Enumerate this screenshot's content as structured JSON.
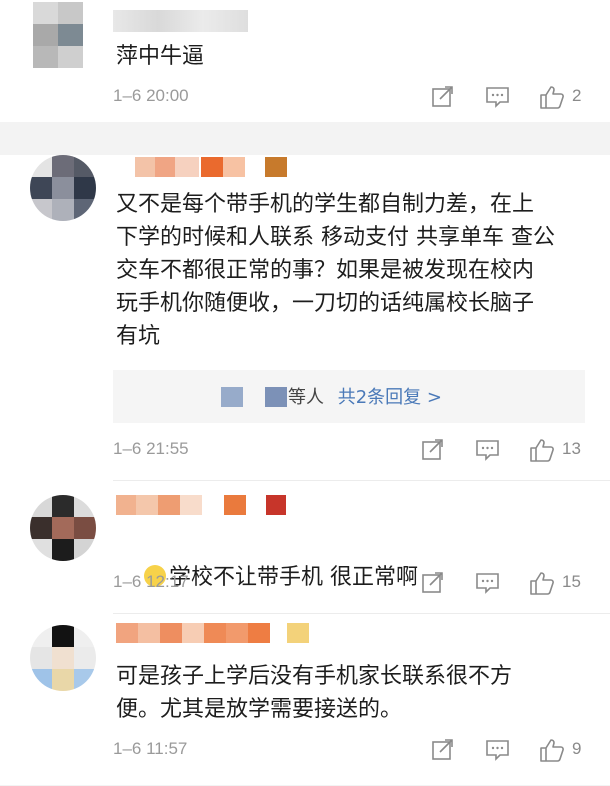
{
  "comments": [
    {
      "text": "萍中牛逼",
      "time": "1–6 20:00",
      "likes": "2",
      "icons": [
        "share-icon",
        "reply-icon",
        "like-icon"
      ]
    },
    {
      "text": "又不是每个带手机的学生都自制力差，在上\n下学的时候和人联系 移动支付 共享单车 查公\n交车不都很正常的事？如果是被发现在校内\n玩手机你随便收，一刀切的话纯属校长脑子\n有坑",
      "reply_prefix": "等人",
      "reply_link": "共2条回复 >",
      "time": "1–6 21:55",
      "likes": "13"
    },
    {
      "emoji": "crying-laughing-emoji",
      "text": "学校不让带手机 很正常啊",
      "time": "1–6 12:17",
      "likes": "15"
    },
    {
      "text": "可是孩子上学后没有手机家长联系很不方\n便。尤其是放学需要接送的。",
      "time": "1–6 11:57",
      "likes": "9"
    }
  ],
  "colors": {
    "text": "#1d1d1d",
    "meta": "#9a9a9a",
    "link": "#4a79b8",
    "background": "#f3f3f3"
  }
}
